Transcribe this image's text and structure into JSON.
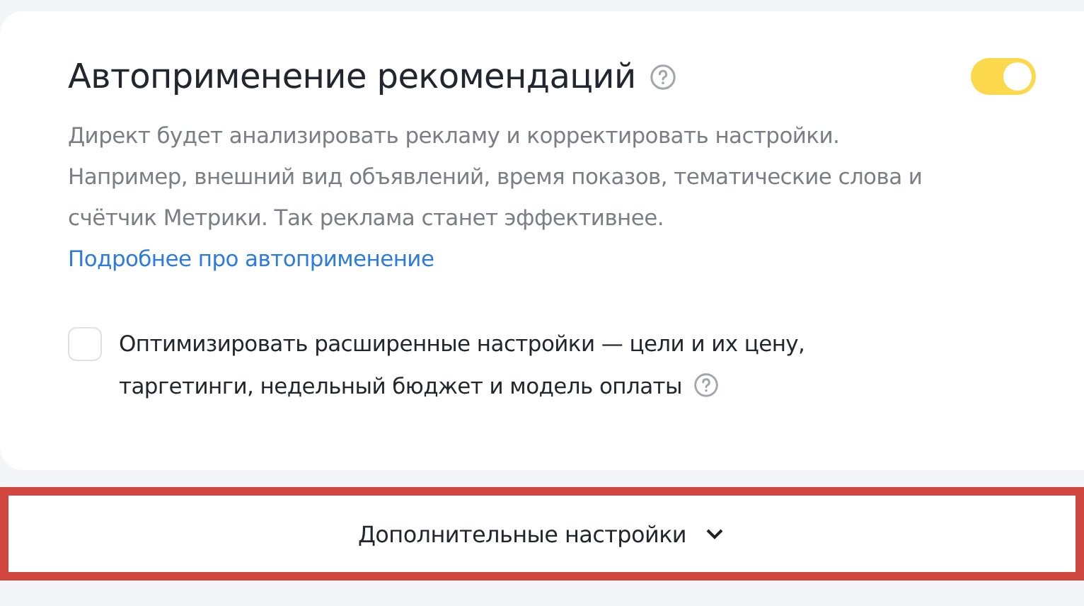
{
  "autoapply": {
    "title": "Автоприменение рекомендаций",
    "enabled": true,
    "description": "Директ будет анализировать рекламу и корректировать настройки. Например, внешний вид объявлений, время показов, тематические слова и счётчик Метрики. Так реклама станет эффективнее.",
    "link": "Подробнее про автоприменение"
  },
  "option": {
    "label": "Оптимизировать расширенные настройки — цели и их цену, таргетинги, недельный бюджет и модель оплаты",
    "checked": false
  },
  "more_settings": {
    "label": "Дополнительные настройки",
    "expanded": false,
    "highlighted": true
  }
}
